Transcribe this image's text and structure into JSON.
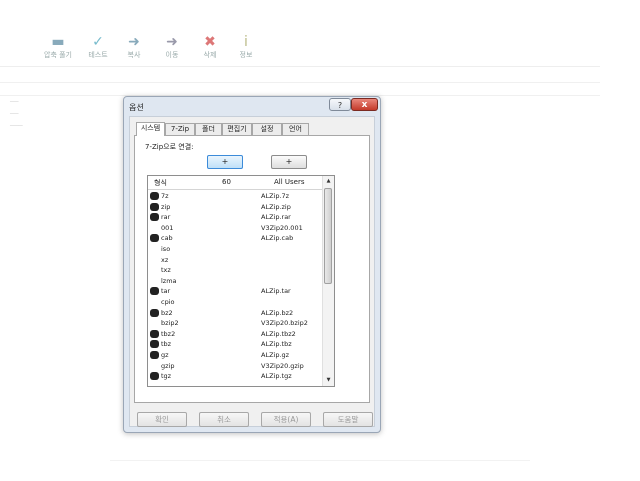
{
  "toolbar": {
    "items": [
      {
        "label": "압축 풀기",
        "icon": "extract-icon"
      },
      {
        "label": "테스트",
        "icon": "test-icon"
      },
      {
        "label": "복사",
        "icon": "copy-icon"
      },
      {
        "label": "이동",
        "icon": "move-icon"
      },
      {
        "label": "삭제",
        "icon": "delete-icon"
      },
      {
        "label": "정보",
        "icon": "info-icon"
      }
    ]
  },
  "dialog": {
    "title": "옵션",
    "help_glyph": "?",
    "close_glyph": "x",
    "tabs": [
      "시스템",
      "7-Zip",
      "폴더",
      "편집기",
      "설정",
      "언어"
    ],
    "active_tab": "시스템",
    "assoc_label": "7-Zip으로 연결:",
    "plus_left": "+",
    "plus_right": "+",
    "list_header": {
      "format": "형식",
      "count": "60",
      "all_users": "All Users"
    },
    "rows": [
      {
        "ext": "7z",
        "prog": "ALZip.7z",
        "icon": true
      },
      {
        "ext": "zip",
        "prog": "ALZip.zip",
        "icon": true
      },
      {
        "ext": "rar",
        "prog": "ALZip.rar",
        "icon": true
      },
      {
        "ext": "001",
        "prog": "V3Zip20.001",
        "icon": false
      },
      {
        "ext": "cab",
        "prog": "ALZip.cab",
        "icon": true
      },
      {
        "ext": "iso",
        "prog": "",
        "icon": false
      },
      {
        "ext": "xz",
        "prog": "",
        "icon": false
      },
      {
        "ext": "txz",
        "prog": "",
        "icon": false
      },
      {
        "ext": "lzma",
        "prog": "",
        "icon": false
      },
      {
        "ext": "tar",
        "prog": "ALZip.tar",
        "icon": true
      },
      {
        "ext": "cpio",
        "prog": "",
        "icon": false
      },
      {
        "ext": "bz2",
        "prog": "ALZip.bz2",
        "icon": true
      },
      {
        "ext": "bzip2",
        "prog": "V3Zip20.bzip2",
        "icon": false
      },
      {
        "ext": "tbz2",
        "prog": "ALZip.tbz2",
        "icon": true
      },
      {
        "ext": "tbz",
        "prog": "ALZip.tbz",
        "icon": true
      },
      {
        "ext": "gz",
        "prog": "ALZip.gz",
        "icon": true
      },
      {
        "ext": "gzip",
        "prog": "V3Zip20.gzip",
        "icon": false
      },
      {
        "ext": "tgz",
        "prog": "ALZip.tgz",
        "icon": true
      }
    ],
    "buttons": {
      "ok": "확인",
      "cancel": "취소",
      "apply": "적용(A)",
      "help": "도움말"
    }
  }
}
